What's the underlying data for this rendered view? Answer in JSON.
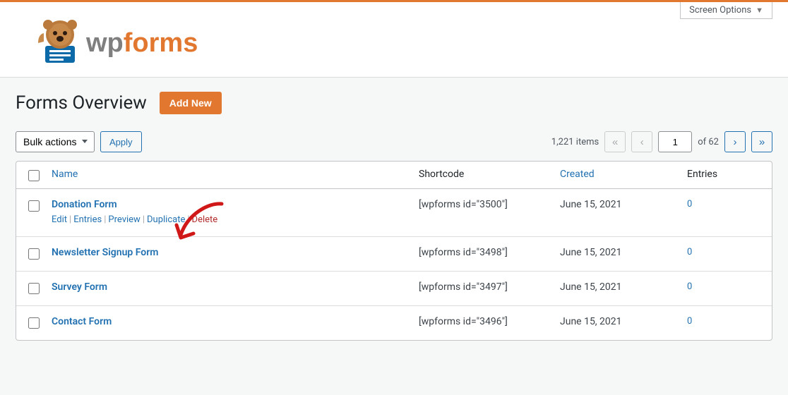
{
  "screen_options": "Screen Options",
  "brand": "wpforms",
  "page_title": "Forms Overview",
  "add_new": "Add New",
  "bulk_actions": "Bulk actions",
  "apply": "Apply",
  "items_count": "1,221 items",
  "page_current": "1",
  "page_of": "of 62",
  "columns": {
    "name": "Name",
    "shortcode": "Shortcode",
    "created": "Created",
    "entries": "Entries"
  },
  "row_actions": {
    "edit": "Edit",
    "entries": "Entries",
    "preview": "Preview",
    "duplicate": "Duplicate",
    "delete": "Delete"
  },
  "rows": [
    {
      "name": "Donation Form",
      "shortcode": "[wpforms id=\"3500\"]",
      "created": "June 15, 2021",
      "entries": "0",
      "hover": true
    },
    {
      "name": "Newsletter Signup Form",
      "shortcode": "[wpforms id=\"3498\"]",
      "created": "June 15, 2021",
      "entries": "0",
      "hover": false
    },
    {
      "name": "Survey Form",
      "shortcode": "[wpforms id=\"3497\"]",
      "created": "June 15, 2021",
      "entries": "0",
      "hover": false
    },
    {
      "name": "Contact Form",
      "shortcode": "[wpforms id=\"3496\"]",
      "created": "June 15, 2021",
      "entries": "0",
      "hover": false
    }
  ]
}
